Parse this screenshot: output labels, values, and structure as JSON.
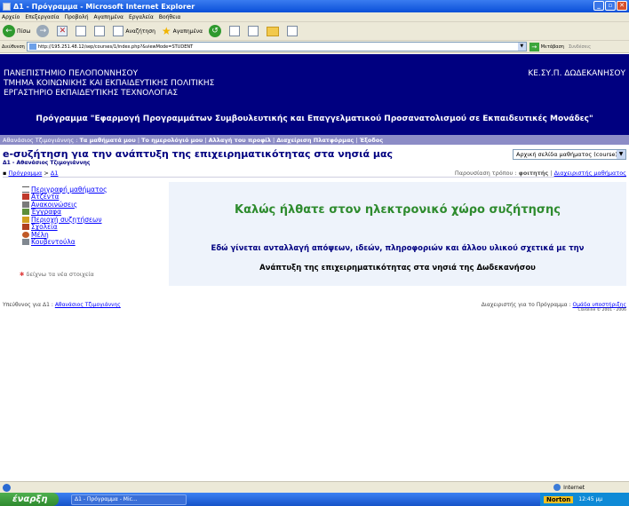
{
  "browser": {
    "title": "Δ1 - Πρόγραμμα - Microsoft Internet Explorer",
    "menu": [
      "Αρχείο",
      "Επεξεργασία",
      "Προβολή",
      "Αγαπημένα",
      "Εργαλεία",
      "Βοήθεια"
    ],
    "toolbar": {
      "back": "Πίσω",
      "search": "Αναζήτηση",
      "favorites": "Αγαπημένα"
    },
    "address_label": "Διεύθυνση",
    "address": "http://195.251.48.12/sep/courses/1/index.php?&viewMode=STUDENT",
    "go_label": "Μετάβαση",
    "links_label": "Συνδέσεις",
    "status_zone": "Internet"
  },
  "site": {
    "university_lines": [
      "ΠΑΝΕΠΙΣΤΗΜΙΟ ΠΕΛΟΠΟΝΝΗΣΟΥ",
      "ΤΜΗΜΑ ΚΟΙΝΩΝΙΚΗΣ ΚΑΙ ΕΚΠΑΙΔΕΥΤΙΚΗΣ ΠΟΛΙΤΙΚΗΣ",
      "ΕΡΓΑΣΤΗΡΙΟ ΕΚΠΑΙΔΕΥΤΙΚΗΣ ΤΕΧΝΟΛΟΓΙΑΣ"
    ],
    "center": "ΚΕ.ΣΥ.Π. ΔΩΔΕΚΑΝΗΣΟΥ",
    "program": "Πρόγραμμα \"Εφαρμογή Προγραμμάτων Συμβουλευτικής και Επαγγελματικού Προσανατολισμού σε Εκπαιδευτικές Μονάδες\""
  },
  "nav": {
    "user": "Αθανάσιος Τζιμογιάννης",
    "links": [
      "Τα μαθήματά μου",
      "Το ημερολόγιό μου",
      "Αλλαγή του προφίλ",
      "Διαχείριση Πλατφόρμας",
      "Έξοδος"
    ]
  },
  "course": {
    "title": "e-συζήτηση για την ανάπτυξη της επιχειρηματικότητας στα νησιά μας",
    "subtitle": "Δ1 - Αθανάσιος Τζιμογιάννης",
    "jump_select": "Αρχική σελίδα μαθήματος (course)",
    "breadcrumb_home": "Πρόγραμμα",
    "breadcrumb_current": "Δ1",
    "view_as_label": "Παρουσίαση τρόπου :",
    "view_as_mode": "φοιτητής",
    "view_as_link": "Διαχειριστής μαθήματος"
  },
  "sidebar": {
    "items": [
      {
        "label": "Περιγραφή μαθήματος",
        "icon": "list-icon"
      },
      {
        "label": "Ατζέντα",
        "icon": "calendar-icon"
      },
      {
        "label": "Ανακοινώσεις",
        "icon": "announcement-icon"
      },
      {
        "label": "Έγγραφα",
        "icon": "documents-icon"
      },
      {
        "label": "Περιοχή συζητήσεων",
        "icon": "forum-icon"
      },
      {
        "label": "Σχολεία",
        "icon": "school-icon"
      },
      {
        "label": "Μέλη",
        "icon": "users-icon"
      },
      {
        "label": "Κουβεντούλα",
        "icon": "chat-icon"
      }
    ],
    "new_items": "δείχνω τα νέα στοιχεία"
  },
  "welcome": {
    "heading": "Καλώς ήλθατε στον ηλεκτρονικό χώρο συζήτησης",
    "line1": "Εδώ γίνεται ανταλλαγή απόψεων, ιδεών, πληροφοριών και άλλου υλικού σχετικά με την",
    "line2": "Ανάπτυξη της επιχειρηματικότητας στα νησιά της Δωδεκανήσου"
  },
  "footer": {
    "responsible_label": "Υπεύθυνος για Δ1 :",
    "responsible_name": "Αθανάσιος Τζιμογιάννης",
    "admin_label": "Διαχειριστής για το Πρόγραμμα :",
    "admin_link": "Ομάδα υποστήριξης",
    "copyright": "Claroline © 2001 - 2006"
  },
  "taskbar": {
    "start": "έναρξη",
    "task": "Δ1 - Πρόγραμμα - Mic...",
    "norton": "Norton",
    "clock": "12:45 μμ"
  }
}
